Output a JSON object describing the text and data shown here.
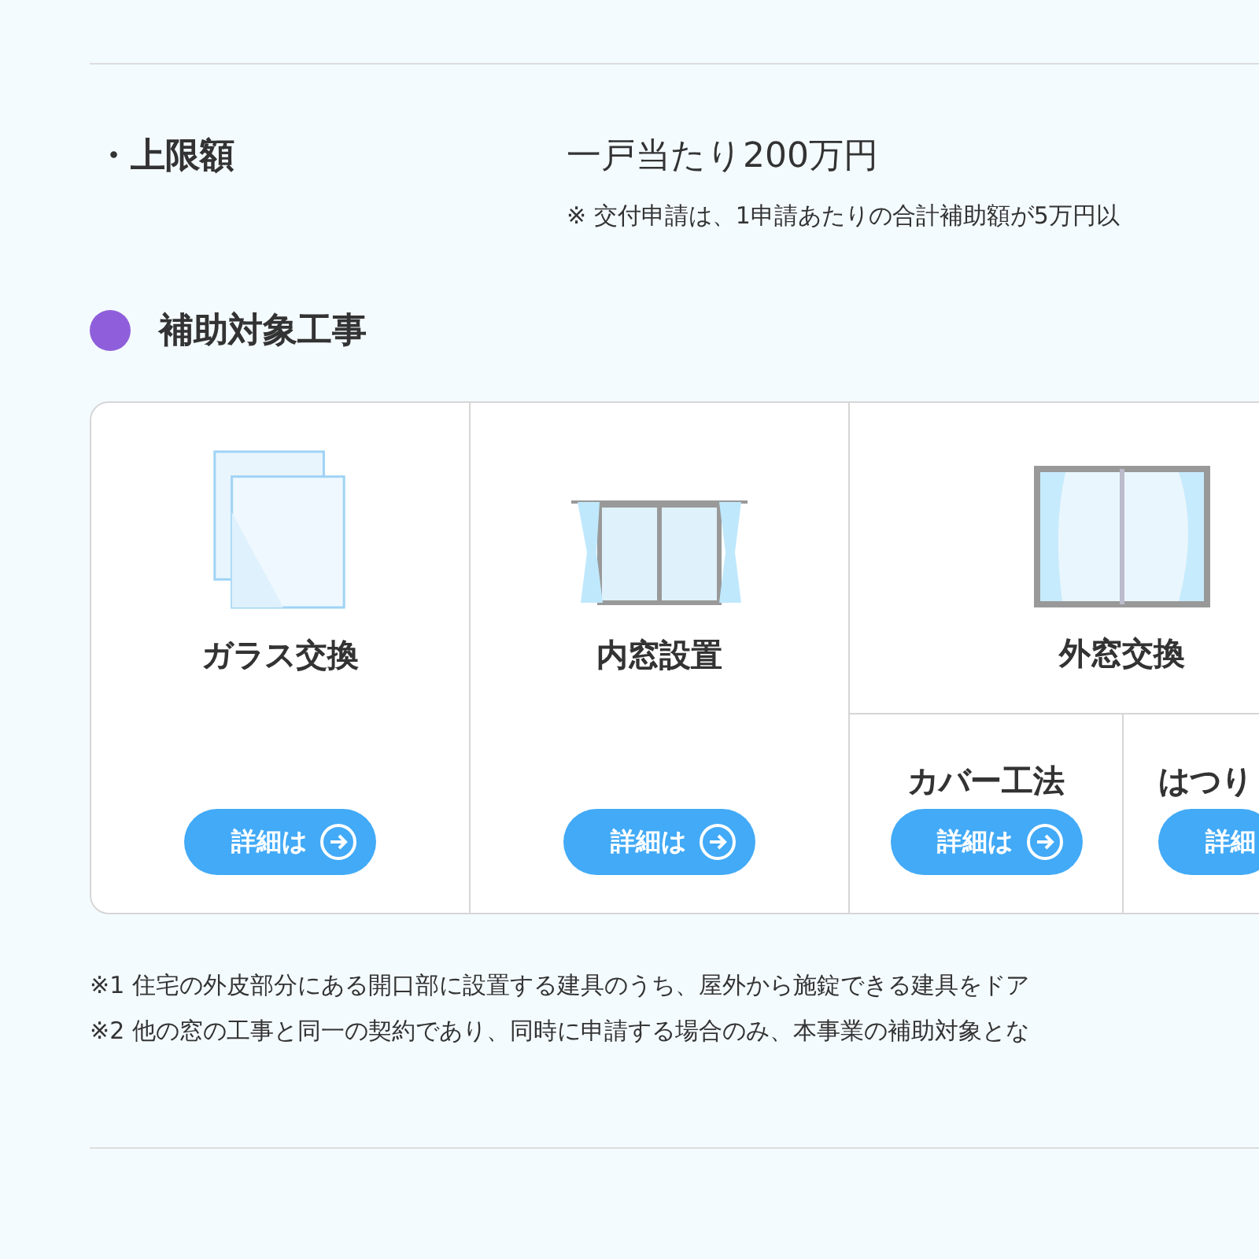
{
  "limit": {
    "label": "・上限額",
    "value": "一戸当たり200万円",
    "note": "※  交付申請は、1申請あたりの合計補助額が5万円以"
  },
  "section": {
    "title": "補助対象工事",
    "color": "#8f5fdb"
  },
  "works": [
    {
      "title": "ガラス交換",
      "kind": "glass",
      "button": {
        "label": "詳細は",
        "arrow": true
      }
    },
    {
      "title": "内窓設置",
      "kind": "inner",
      "button": {
        "label": "詳細は",
        "arrow": true
      }
    },
    {
      "title": "外窓交換",
      "kind": "outer",
      "methods": [
        {
          "title": "カバー工法",
          "button": {
            "label": "詳細は",
            "arrow": true
          }
        },
        {
          "title": "はつり",
          "button": {
            "label": "詳細",
            "arrow": false
          }
        }
      ]
    }
  ],
  "footnotes": [
    "※1 住宅の外皮部分にある開口部に設置する建具のうち、屋外から施錠できる建具をドア",
    "※2 他の窓の工事と同一の契約であり、同時に申請する場合のみ、本事業の補助対象とな"
  ]
}
